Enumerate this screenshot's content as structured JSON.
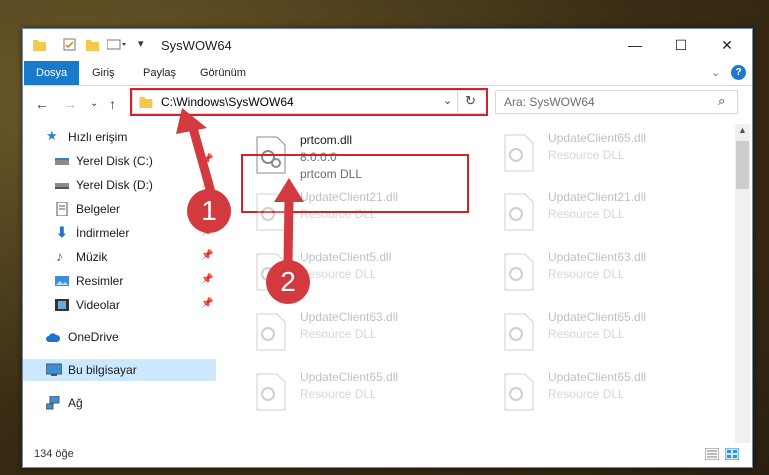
{
  "window": {
    "title": "SysWOW64"
  },
  "ribbon": {
    "tabs": [
      "Dosya",
      "Giriş",
      "Paylaş",
      "Görünüm"
    ]
  },
  "nav": {
    "address": "C:\\Windows\\SysWOW64",
    "search_placeholder": "Ara: SysWOW64"
  },
  "sidebar": {
    "items": [
      {
        "label": "Hızlı erişim",
        "icon": "star-icon"
      },
      {
        "label": "Yerel Disk (C:)",
        "icon": "drive-icon"
      },
      {
        "label": "Yerel Disk (D:)",
        "icon": "drive-icon"
      },
      {
        "label": "Belgeler",
        "icon": "documents-icon"
      },
      {
        "label": "İndirmeler",
        "icon": "download-icon"
      },
      {
        "label": "Müzik",
        "icon": "music-icon"
      },
      {
        "label": "Resimler",
        "icon": "pictures-icon"
      },
      {
        "label": "Videolar",
        "icon": "videos-icon"
      },
      {
        "label": "OneDrive",
        "icon": "cloud-icon"
      },
      {
        "label": "Bu bilgisayar",
        "icon": "computer-icon"
      },
      {
        "label": "Ağ",
        "icon": "network-icon"
      }
    ]
  },
  "files": [
    {
      "name": "prtcom.dll",
      "version": "8.0.0.0",
      "desc": "prtcom DLL"
    },
    {
      "name": "UpdateClient65.dll",
      "desc": "Resource DLL"
    },
    {
      "name": "UpdateClient21.dll",
      "desc": "Resource DLL"
    },
    {
      "name": "UpdateClient21.dll",
      "desc": "Resource DLL"
    },
    {
      "name": "UpdateClient5.dll",
      "desc": "Resource DLL"
    },
    {
      "name": "UpdateClient63.dll",
      "desc": "Resource DLL"
    },
    {
      "name": "UpdateClient63.dll",
      "desc": "Resource DLL"
    },
    {
      "name": "UpdateClient65.dll",
      "desc": "Resource DLL"
    },
    {
      "name": "UpdateClient65.dll",
      "desc": "Resource DLL"
    },
    {
      "name": "UpdateClient65.dll",
      "desc": "Resource DLL"
    }
  ],
  "status": {
    "item_count": "134 öğe"
  },
  "callouts": {
    "one": "1",
    "two": "2"
  },
  "colors": {
    "accent": "#1979ca",
    "highlight": "#d2232a",
    "selected": "#cce8ff"
  }
}
